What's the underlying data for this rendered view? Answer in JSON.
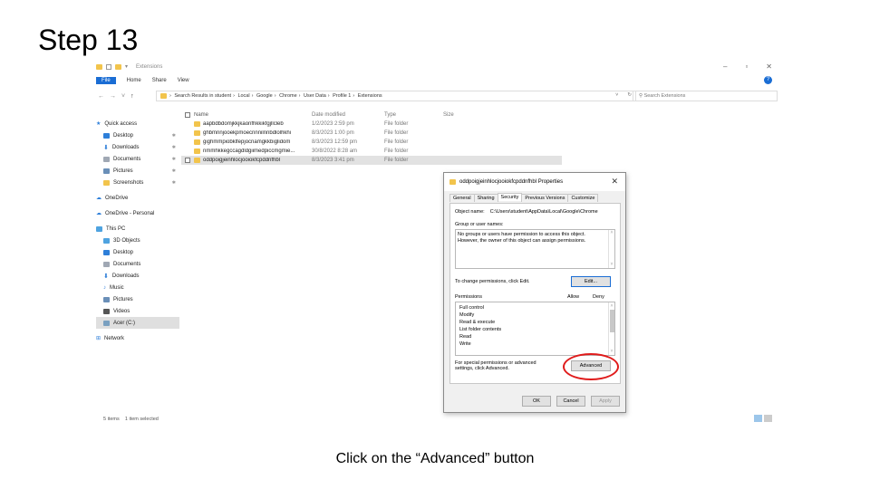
{
  "slide": {
    "title": "Step 13",
    "caption": "Click on the “Advanced” button"
  },
  "explorer": {
    "window_title": "Extensions",
    "ribbon": {
      "file": "File",
      "tabs": [
        "Home",
        "Share",
        "View"
      ]
    },
    "address": {
      "crumbs": [
        "Search Results in student",
        "Local",
        "Google",
        "Chrome",
        "User Data",
        "Profile 1",
        "Extensions"
      ],
      "search_placeholder": "Search Extensions"
    },
    "nav": {
      "quick_access": "Quick access",
      "items": [
        {
          "label": "Desktop",
          "icon": "desktop-icon",
          "color": "#2e7fd9",
          "pinned": true
        },
        {
          "label": "Downloads",
          "icon": "download-icon",
          "color": "#2e7fd9",
          "pinned": true
        },
        {
          "label": "Documents",
          "icon": "documents-icon",
          "color": "#a0a8b4",
          "pinned": true
        },
        {
          "label": "Pictures",
          "icon": "pictures-icon",
          "color": "#6a8fb8",
          "pinned": true
        },
        {
          "label": "Screenshots",
          "icon": "folder-icon",
          "color": "#f2c44c",
          "pinned": true
        }
      ],
      "onedrive": "OneDrive",
      "onedrive_personal": "OneDrive - Personal",
      "this_pc": "This PC",
      "pc_items": [
        {
          "label": "3D Objects",
          "color": "#4fa3e0"
        },
        {
          "label": "Desktop",
          "color": "#2e7fd9"
        },
        {
          "label": "Documents",
          "color": "#a0a8b4"
        },
        {
          "label": "Downloads",
          "color": "#2e7fd9"
        },
        {
          "label": "Music",
          "color": "#2e7fd9"
        },
        {
          "label": "Pictures",
          "color": "#6a8fb8"
        },
        {
          "label": "Videos",
          "color": "#555555"
        },
        {
          "label": "Acer (C:)",
          "color": "#7aa0c0"
        }
      ],
      "network": "Network"
    },
    "columns": [
      "Name",
      "Date modified",
      "Type",
      "Size"
    ],
    "files": [
      {
        "name": "aapbdbdomjkkjkaonfhkkikfgjllcleb",
        "date": "1/2/2023 2:59 pm",
        "type": "File folder",
        "selected": false
      },
      {
        "name": "ghbmnnjooekpmoecnnnilnnbdlolhkhi",
        "date": "8/3/2023 1:00 pm",
        "type": "File folder",
        "selected": false
      },
      {
        "name": "gighmmpiobklfepjocnamgkkbiglidom",
        "date": "8/3/2023 12:59 pm",
        "type": "File folder",
        "selected": false
      },
      {
        "name": "nmmhkkegccagdldgiimedpiccmgmie...",
        "date": "30/8/2022 8:28 am",
        "type": "File folder",
        "selected": false
      },
      {
        "name": "oddpoigjeinhlocjooiokfcpddnfhbl",
        "date": "8/3/2023 3:41 pm",
        "type": "File folder",
        "selected": true
      }
    ],
    "status": {
      "items": "5 items",
      "selected": "1 item selected"
    }
  },
  "dialog": {
    "title": "oddpoigjeinhlocjooiokfcpddnfhbl Properties",
    "tabs": [
      "General",
      "Sharing",
      "Security",
      "Previous Versions",
      "Customize"
    ],
    "active_tab": "Security",
    "object_name_label": "Object name:",
    "object_name_value": "C:\\Users\\student\\AppData\\Local\\Google\\Chrome",
    "groups_label": "Group or user names:",
    "groups_text": "No groups or users have permission to access this object. However, the owner of this object can assign permissions.",
    "change_text": "To change permissions, click Edit.",
    "edit_button": "Edit...",
    "permissions_label": "Permissions",
    "allow_label": "Allow",
    "deny_label": "Deny",
    "permissions": [
      "Full control",
      "Modify",
      "Read & execute",
      "List folder contents",
      "Read",
      "Write"
    ],
    "special_text": "For special permissions or advanced settings, click Advanced.",
    "advanced_button": "Advanced",
    "ok": "OK",
    "cancel": "Cancel",
    "apply": "Apply"
  },
  "colors": {
    "accent": "#1a6dd4",
    "highlight": "#e01b1b",
    "folder": "#f2c44c"
  }
}
